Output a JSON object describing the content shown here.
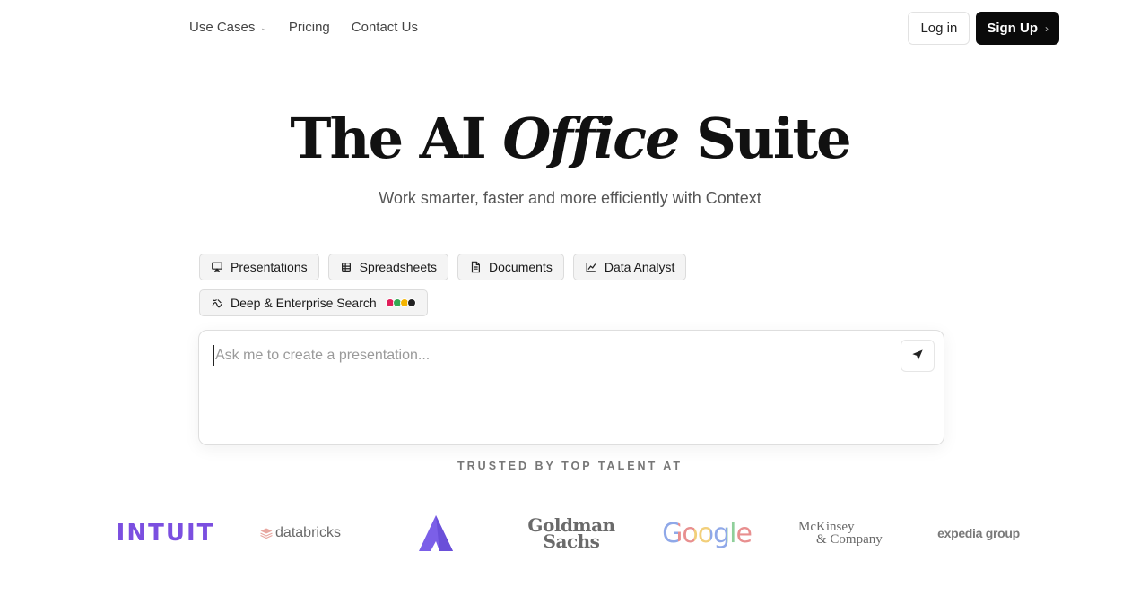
{
  "nav": {
    "links": [
      {
        "label": "Use Cases",
        "has_dropdown": true
      },
      {
        "label": "Pricing"
      },
      {
        "label": "Contact Us"
      }
    ],
    "login_label": "Log in",
    "signup_label": "Sign Up"
  },
  "hero": {
    "title_part1": "The AI",
    "title_italic": "Office",
    "title_part2": "Suite",
    "subtitle": "Work smarter, faster and more efficiently with Context"
  },
  "tabs": [
    {
      "label": "Presentations",
      "icon": "presentation-icon"
    },
    {
      "label": "Spreadsheets",
      "icon": "spreadsheet-icon"
    },
    {
      "label": "Documents",
      "icon": "document-icon"
    },
    {
      "label": "Data Analyst",
      "icon": "chart-line-icon"
    },
    {
      "label": "Deep & Enterprise Search",
      "icon": "search-link-icon"
    }
  ],
  "prompt": {
    "placeholder": "Ask me to create a presentation..."
  },
  "trusted": {
    "heading": "TRUSTED BY TOP TALENT AT",
    "logos": [
      {
        "name": "INTUIT",
        "color": "#7b4fe0"
      },
      {
        "name": "databricks"
      },
      {
        "name": "atlassian-mark"
      },
      {
        "name_line1": "Goldman",
        "name_line2": "Sachs"
      },
      {
        "name": "Google"
      },
      {
        "name_line1": "McKinsey",
        "name_line2": "& Company"
      },
      {
        "name": "expedia group"
      }
    ]
  },
  "colors": {
    "accent_dark": "#0a0a0a",
    "intuit_purple": "#7b4fe0",
    "atlassian_purple": "#7b5fe8"
  }
}
